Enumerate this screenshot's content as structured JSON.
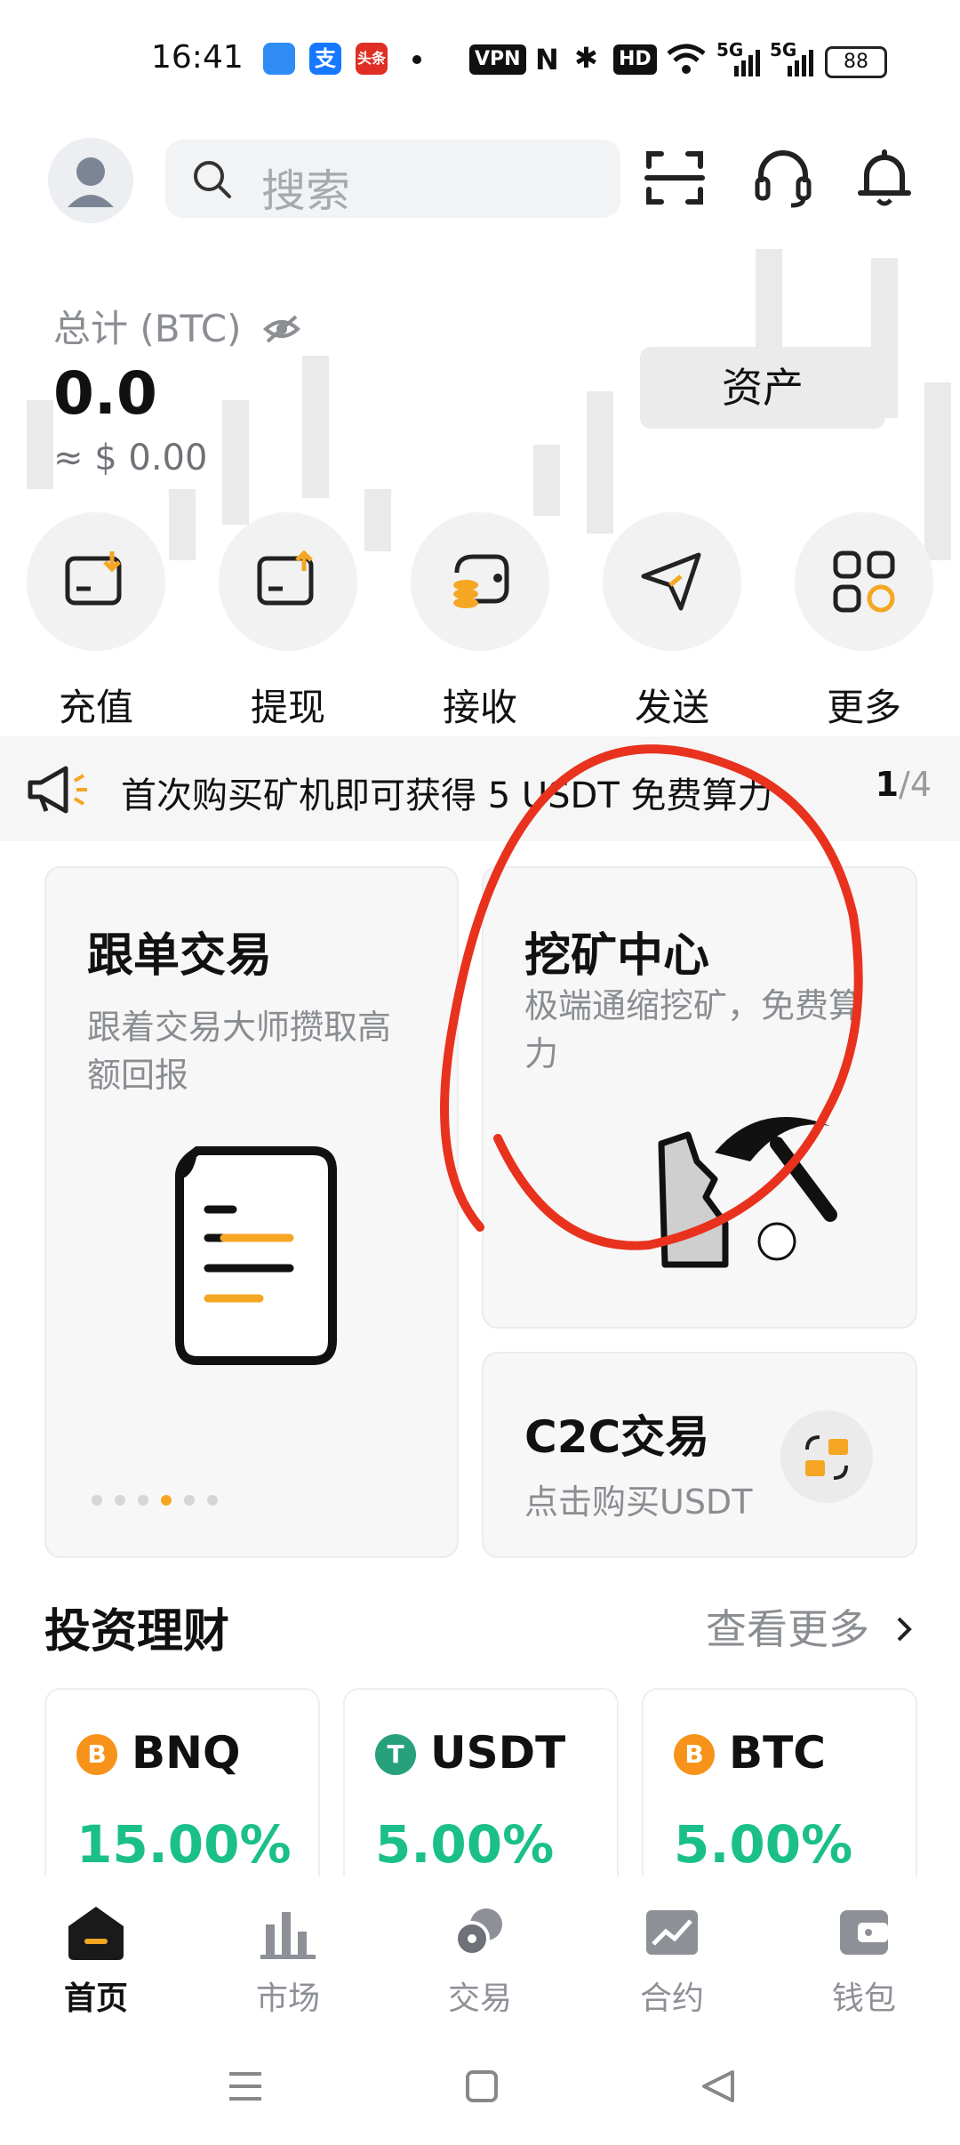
{
  "status_bar": {
    "time": "16:41",
    "vpn": "VPN",
    "hd": "HD",
    "net1": "5G",
    "net2": "5G",
    "battery": "88"
  },
  "header": {
    "search_placeholder": "搜索"
  },
  "balance": {
    "label": "总计 (BTC)",
    "value": "0.0",
    "usd": "≈ $ 0.00",
    "assets_button": "资产"
  },
  "quick_actions": [
    {
      "label": "充值",
      "icon": "deposit-icon"
    },
    {
      "label": "提现",
      "icon": "withdraw-icon"
    },
    {
      "label": "接收",
      "icon": "receive-icon"
    },
    {
      "label": "发送",
      "icon": "send-icon"
    },
    {
      "label": "更多",
      "icon": "more-grid-icon"
    }
  ],
  "notice": {
    "text": "首次购买矿机即可获得 5 USDT 免费算力",
    "page_current": "1",
    "page_total": "/4"
  },
  "cards": {
    "copy_trade": {
      "title": "跟单交易",
      "desc": "跟着交易大师攒取高额回报"
    },
    "mining": {
      "title": "挖矿中心",
      "desc": "极端通缩挖矿，免费算力"
    },
    "c2c": {
      "title": "C2C交易",
      "desc": "点击购买USDT"
    }
  },
  "invest": {
    "title": "投资理财",
    "more": "查看更多",
    "items": [
      {
        "name": "BNQ",
        "rate": "15.00%",
        "coin_symbol": "B",
        "color": "#f7931a"
      },
      {
        "name": "USDT",
        "rate": "5.00%",
        "coin_symbol": "T",
        "color": "#26a17b"
      },
      {
        "name": "BTC",
        "rate": "5.00%",
        "coin_symbol": "B",
        "color": "#f7931a"
      }
    ]
  },
  "bottom_nav": [
    {
      "label": "首页",
      "icon": "home-icon",
      "active": true
    },
    {
      "label": "市场",
      "icon": "market-icon"
    },
    {
      "label": "交易",
      "icon": "trade-icon"
    },
    {
      "label": "合约",
      "icon": "contract-icon"
    },
    {
      "label": "钱包",
      "icon": "wallet-icon"
    }
  ],
  "colors": {
    "accent": "#f5a623",
    "positive": "#1bbf8a",
    "annotation": "#e8321e"
  }
}
